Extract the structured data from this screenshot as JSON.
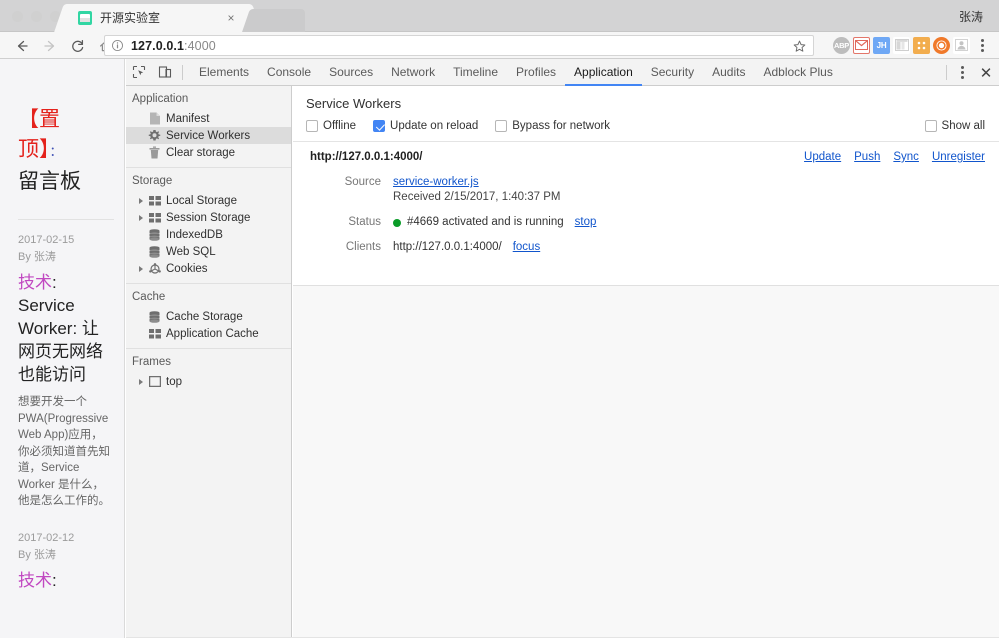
{
  "browser": {
    "window_controls": [
      "close",
      "minimize",
      "maximize"
    ],
    "tab": {
      "title": "开源实验室",
      "favicon": "page-favicon",
      "close_label": "×"
    },
    "profile_name": "张涛",
    "nav": {
      "back": "back-arrow",
      "forward": "forward-arrow",
      "reload": "reload",
      "home": "home"
    },
    "omnibox": {
      "url_host": "127.0.0.1",
      "url_port": ":4000",
      "full_url": "127.0.0.1:4000",
      "info_icon": "info-circle-icon",
      "star_icon": "bookmark-star-icon"
    },
    "extensions": [
      {
        "name": "adblock-plus",
        "label": "ABP",
        "color": "#b9b9b9"
      },
      {
        "name": "gmail",
        "label": "M",
        "color": "#ffffff"
      },
      {
        "name": "jh-extension",
        "label": "JH",
        "color": "#6fa8f5"
      },
      {
        "name": "columns-extension",
        "label": "",
        "color": "#d8d8d8"
      },
      {
        "name": "grid-extension",
        "label": "",
        "color": "#f0a840"
      },
      {
        "name": "globe-extension",
        "label": "",
        "color": "#f07a20"
      },
      {
        "name": "person-extension",
        "label": "",
        "color": "#c9c9c9"
      }
    ],
    "menu_icon": "kebab-menu-icon"
  },
  "page": {
    "hero": {
      "bracket_open": "【置",
      "bracket_close": "顶】",
      "colon": "：",
      "rest": "留言板"
    },
    "posts": [
      {
        "date": "2017-02-15",
        "author": "By 张涛",
        "category": "技术",
        "title": ": Service Worker: 让网页无网络也能访问",
        "excerpt": "想要开发一个 PWA(Progressive Web App)应用，你必须知道首先知道，Service Worker 是什么，他是怎么工作的。"
      },
      {
        "date": "2017-02-12",
        "author": "By 张涛",
        "category": "技术",
        "title": ":",
        "excerpt": ""
      }
    ]
  },
  "devtools": {
    "toolbar": {
      "inspect_icon": "inspect-element-icon",
      "device_icon": "toggle-device-toolbar-icon",
      "tabs": [
        {
          "label": "Elements",
          "active": false
        },
        {
          "label": "Console",
          "active": false
        },
        {
          "label": "Sources",
          "active": false
        },
        {
          "label": "Network",
          "active": false
        },
        {
          "label": "Timeline",
          "active": false
        },
        {
          "label": "Profiles",
          "active": false
        },
        {
          "label": "Application",
          "active": true
        },
        {
          "label": "Security",
          "active": false
        },
        {
          "label": "Audits",
          "active": false
        },
        {
          "label": "Adblock Plus",
          "active": false
        }
      ],
      "more_icon": "kebab-menu-icon",
      "close_icon": "close-icon"
    },
    "sidebar": {
      "sections": [
        {
          "title": "Application",
          "items": [
            {
              "label": "Manifest",
              "icon": "manifest-file-icon",
              "expandable": false,
              "selected": false
            },
            {
              "label": "Service Workers",
              "icon": "gear-icon",
              "expandable": false,
              "selected": true
            },
            {
              "label": "Clear storage",
              "icon": "trash-icon",
              "expandable": false,
              "selected": false
            }
          ]
        },
        {
          "title": "Storage",
          "items": [
            {
              "label": "Local Storage",
              "icon": "table-icon",
              "expandable": true,
              "selected": false
            },
            {
              "label": "Session Storage",
              "icon": "table-icon",
              "expandable": true,
              "selected": false
            },
            {
              "label": "IndexedDB",
              "icon": "database-icon",
              "expandable": false,
              "selected": false
            },
            {
              "label": "Web SQL",
              "icon": "database-icon",
              "expandable": false,
              "selected": false
            },
            {
              "label": "Cookies",
              "icon": "cookie-icon",
              "expandable": true,
              "selected": false
            }
          ]
        },
        {
          "title": "Cache",
          "items": [
            {
              "label": "Cache Storage",
              "icon": "database-icon",
              "expandable": false,
              "selected": false
            },
            {
              "label": "Application Cache",
              "icon": "table-icon",
              "expandable": false,
              "selected": false
            }
          ]
        },
        {
          "title": "Frames",
          "items": [
            {
              "label": "top",
              "icon": "frame-icon",
              "expandable": true,
              "selected": false
            }
          ]
        }
      ]
    },
    "service_workers": {
      "panel_title": "Service Workers",
      "options": [
        {
          "label": "Offline",
          "checked": false
        },
        {
          "label": "Update on reload",
          "checked": true
        },
        {
          "label": "Bypass for network",
          "checked": false
        }
      ],
      "show_all": {
        "label": "Show all",
        "checked": false
      },
      "registration": {
        "origin": "http://127.0.0.1:4000/",
        "actions": [
          "Update",
          "Push",
          "Sync",
          "Unregister"
        ],
        "rows": [
          {
            "key": "Source",
            "link": "service-worker.js",
            "sub": "Received 2/15/2017, 1:40:37 PM"
          },
          {
            "key": "Status",
            "status_text": "#4669 activated and is running",
            "status_color": "#0a9c28",
            "action": "stop"
          },
          {
            "key": "Clients",
            "client_url": "http://127.0.0.1:4000/",
            "action": "focus"
          }
        ]
      }
    }
  },
  "colors": {
    "accent_blue": "#4285f4",
    "link_blue": "#1155cc",
    "status_green": "#0a9c28",
    "favicon_green": "#32d6a3",
    "category_purple": "#c148c1",
    "hero_red": "#e4221c"
  }
}
